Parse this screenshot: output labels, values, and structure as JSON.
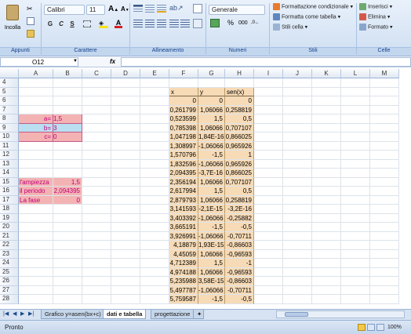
{
  "ribbon": {
    "paste_label": "Incolla",
    "font_name": "Calibri",
    "font_size": "11",
    "bold": "G",
    "italic": "C",
    "underline": "S",
    "number_format": "Generale",
    "percent": "%",
    "thousands": "000",
    "cond_format": "Formattazione condizionale",
    "format_table": "Formatta come tabella",
    "cell_styles": "Stili cella",
    "insert": "Inserisci",
    "delete": "Elimina",
    "format": "Formato",
    "groups": {
      "clipboard": "Appunti",
      "font": "Carattere",
      "alignment": "Allineamento",
      "numbers": "Numeri",
      "styles": "Stili",
      "cells": "Celle"
    }
  },
  "formula_bar": {
    "name_box": "O12",
    "fx": "fx",
    "content": ""
  },
  "columns": [
    "A",
    "B",
    "C",
    "D",
    "E",
    "F",
    "G",
    "H",
    "I",
    "J",
    "K",
    "L",
    "M"
  ],
  "rows": [
    {
      "n": "4",
      "a": "",
      "b": "",
      "f": "",
      "g": "",
      "h": ""
    },
    {
      "n": "5",
      "a": "",
      "b": "",
      "f": "x",
      "g": "y",
      "h": "sen(x)"
    },
    {
      "n": "6",
      "a": "",
      "b": "",
      "f": "0",
      "g": "0",
      "h": "0"
    },
    {
      "n": "7",
      "a": "",
      "b": "",
      "f": "0,261799",
      "g": "1,06066",
      "h": "0,258819"
    },
    {
      "n": "8",
      "a": "a=",
      "b": "1,5",
      "f": "0,523599",
      "g": "1,5",
      "h": "0,5"
    },
    {
      "n": "9",
      "a": "b=",
      "b": "3",
      "f": "0,785398",
      "g": "1,06066",
      "h": "0,707107"
    },
    {
      "n": "10",
      "a": "c=",
      "b": "0",
      "f": "1,047198",
      "g": "1,84E-16",
      "h": "0,866025"
    },
    {
      "n": "11",
      "a": "",
      "b": "",
      "f": "1,308997",
      "g": "-1,06066",
      "h": "0,965926"
    },
    {
      "n": "12",
      "a": "",
      "b": "",
      "f": "1,570796",
      "g": "-1,5",
      "h": "1"
    },
    {
      "n": "13",
      "a": "",
      "b": "",
      "f": "1,832596",
      "g": "-1,06066",
      "h": "0,965926"
    },
    {
      "n": "14",
      "a": "",
      "b": "",
      "f": "2,094395",
      "g": "-3,7E-16",
      "h": "0,866025"
    },
    {
      "n": "15",
      "a": "l'ampiezza",
      "b": "1,5",
      "f": "2,356194",
      "g": "1,06066",
      "h": "0,707107"
    },
    {
      "n": "16",
      "a": "il periodo",
      "b": "2,094395",
      "f": "2,617994",
      "g": "1,5",
      "h": "0,5"
    },
    {
      "n": "17",
      "a": "La fase",
      "b": "0",
      "f": "2,879793",
      "g": "1,06066",
      "h": "0,258819"
    },
    {
      "n": "18",
      "a": "",
      "b": "",
      "f": "3,141593",
      "g": "-2,1E-15",
      "h": "-3,2E-16"
    },
    {
      "n": "19",
      "a": "",
      "b": "",
      "f": "3,403392",
      "g": "-1,06066",
      "h": "-0,25882"
    },
    {
      "n": "20",
      "a": "",
      "b": "",
      "f": "3,665191",
      "g": "-1,5",
      "h": "-0,5"
    },
    {
      "n": "21",
      "a": "",
      "b": "",
      "f": "3,926991",
      "g": "-1,06066",
      "h": "-0,70711"
    },
    {
      "n": "22",
      "a": "",
      "b": "",
      "f": "4,18879",
      "g": "1,93E-15",
      "h": "-0,86603"
    },
    {
      "n": "23",
      "a": "",
      "b": "",
      "f": "4,45059",
      "g": "1,06066",
      "h": "-0,96593"
    },
    {
      "n": "24",
      "a": "",
      "b": "",
      "f": "4,712389",
      "g": "1,5",
      "h": "-1"
    },
    {
      "n": "25",
      "a": "",
      "b": "",
      "f": "4,974188",
      "g": "1,06066",
      "h": "-0,96593"
    },
    {
      "n": "26",
      "a": "",
      "b": "",
      "f": "5,235988",
      "g": "3,58E-15",
      "h": "-0,86603"
    },
    {
      "n": "27",
      "a": "",
      "b": "",
      "f": "5,497787",
      "g": "-1,06066",
      "h": "-0,70711"
    },
    {
      "n": "28",
      "a": "",
      "b": "",
      "f": "5,759587",
      "g": "-1,5",
      "h": "-0,5"
    }
  ],
  "sheet_tabs": [
    "Grafico y=asen(bx+c)",
    "dati e tabella",
    "progettazione"
  ],
  "active_tab": "dati e tabella",
  "status": {
    "ready": "Pronto",
    "zoom": "100%"
  }
}
